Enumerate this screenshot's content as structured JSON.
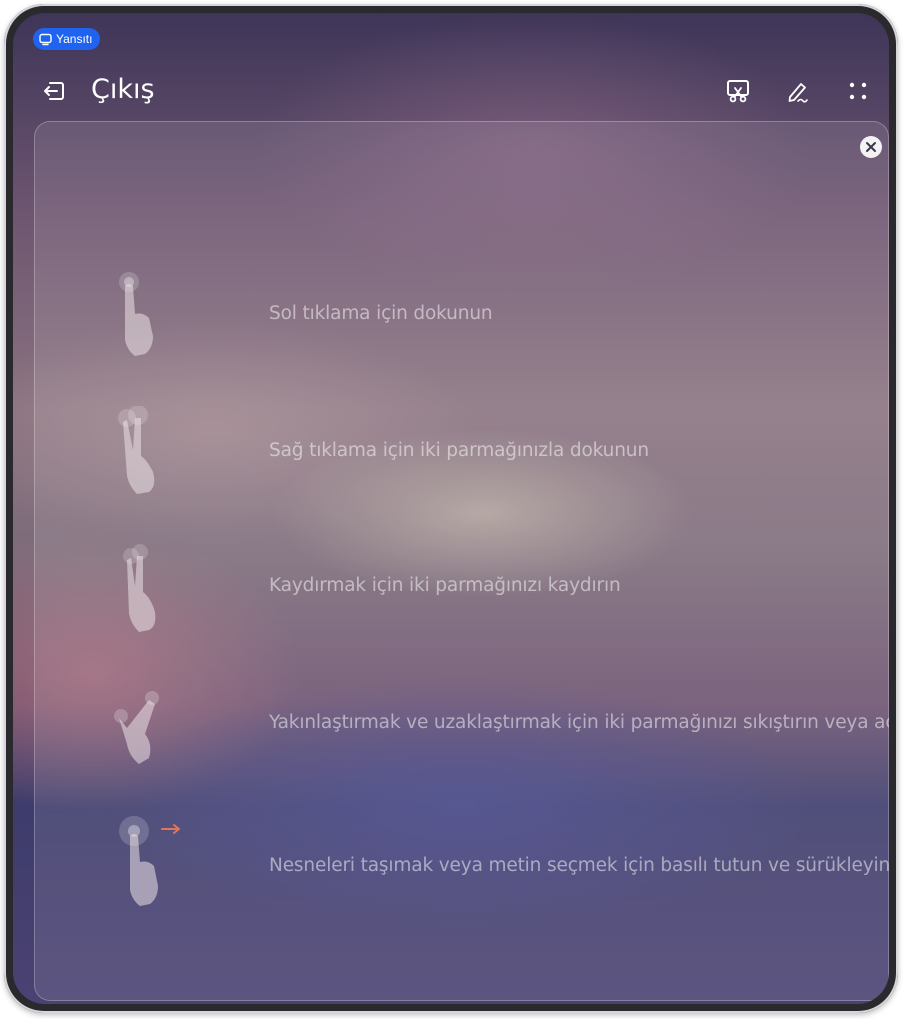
{
  "status": {
    "mirror_badge": "Yansıtı"
  },
  "toolbar": {
    "exit_label": "Çıkış"
  },
  "icons": {
    "exit": "exit-icon",
    "screenshot": "screenshot-icon",
    "annotate": "pen-icon",
    "more": "more-icon",
    "close": "close-icon"
  },
  "gestures": [
    {
      "label": "Sol tıklama için dokunun",
      "icon": "single-tap-icon"
    },
    {
      "label": "Sağ tıklama için iki parmağınızla dokunun",
      "icon": "two-finger-tap-icon"
    },
    {
      "label": "Kaydırmak için iki parmağınızı kaydırın",
      "icon": "two-finger-scroll-icon"
    },
    {
      "label": "Yakınlaştırmak ve uzaklaştırmak için iki parmağınızı sıkıştırın veya açın",
      "icon": "pinch-icon"
    },
    {
      "label": "Nesneleri taşımak veya metin seçmek için basılı tutun ve sürükleyin",
      "icon": "press-drag-icon"
    }
  ],
  "colors": {
    "badge": "#1f63f0",
    "drag_arrow": "#e5735a"
  }
}
